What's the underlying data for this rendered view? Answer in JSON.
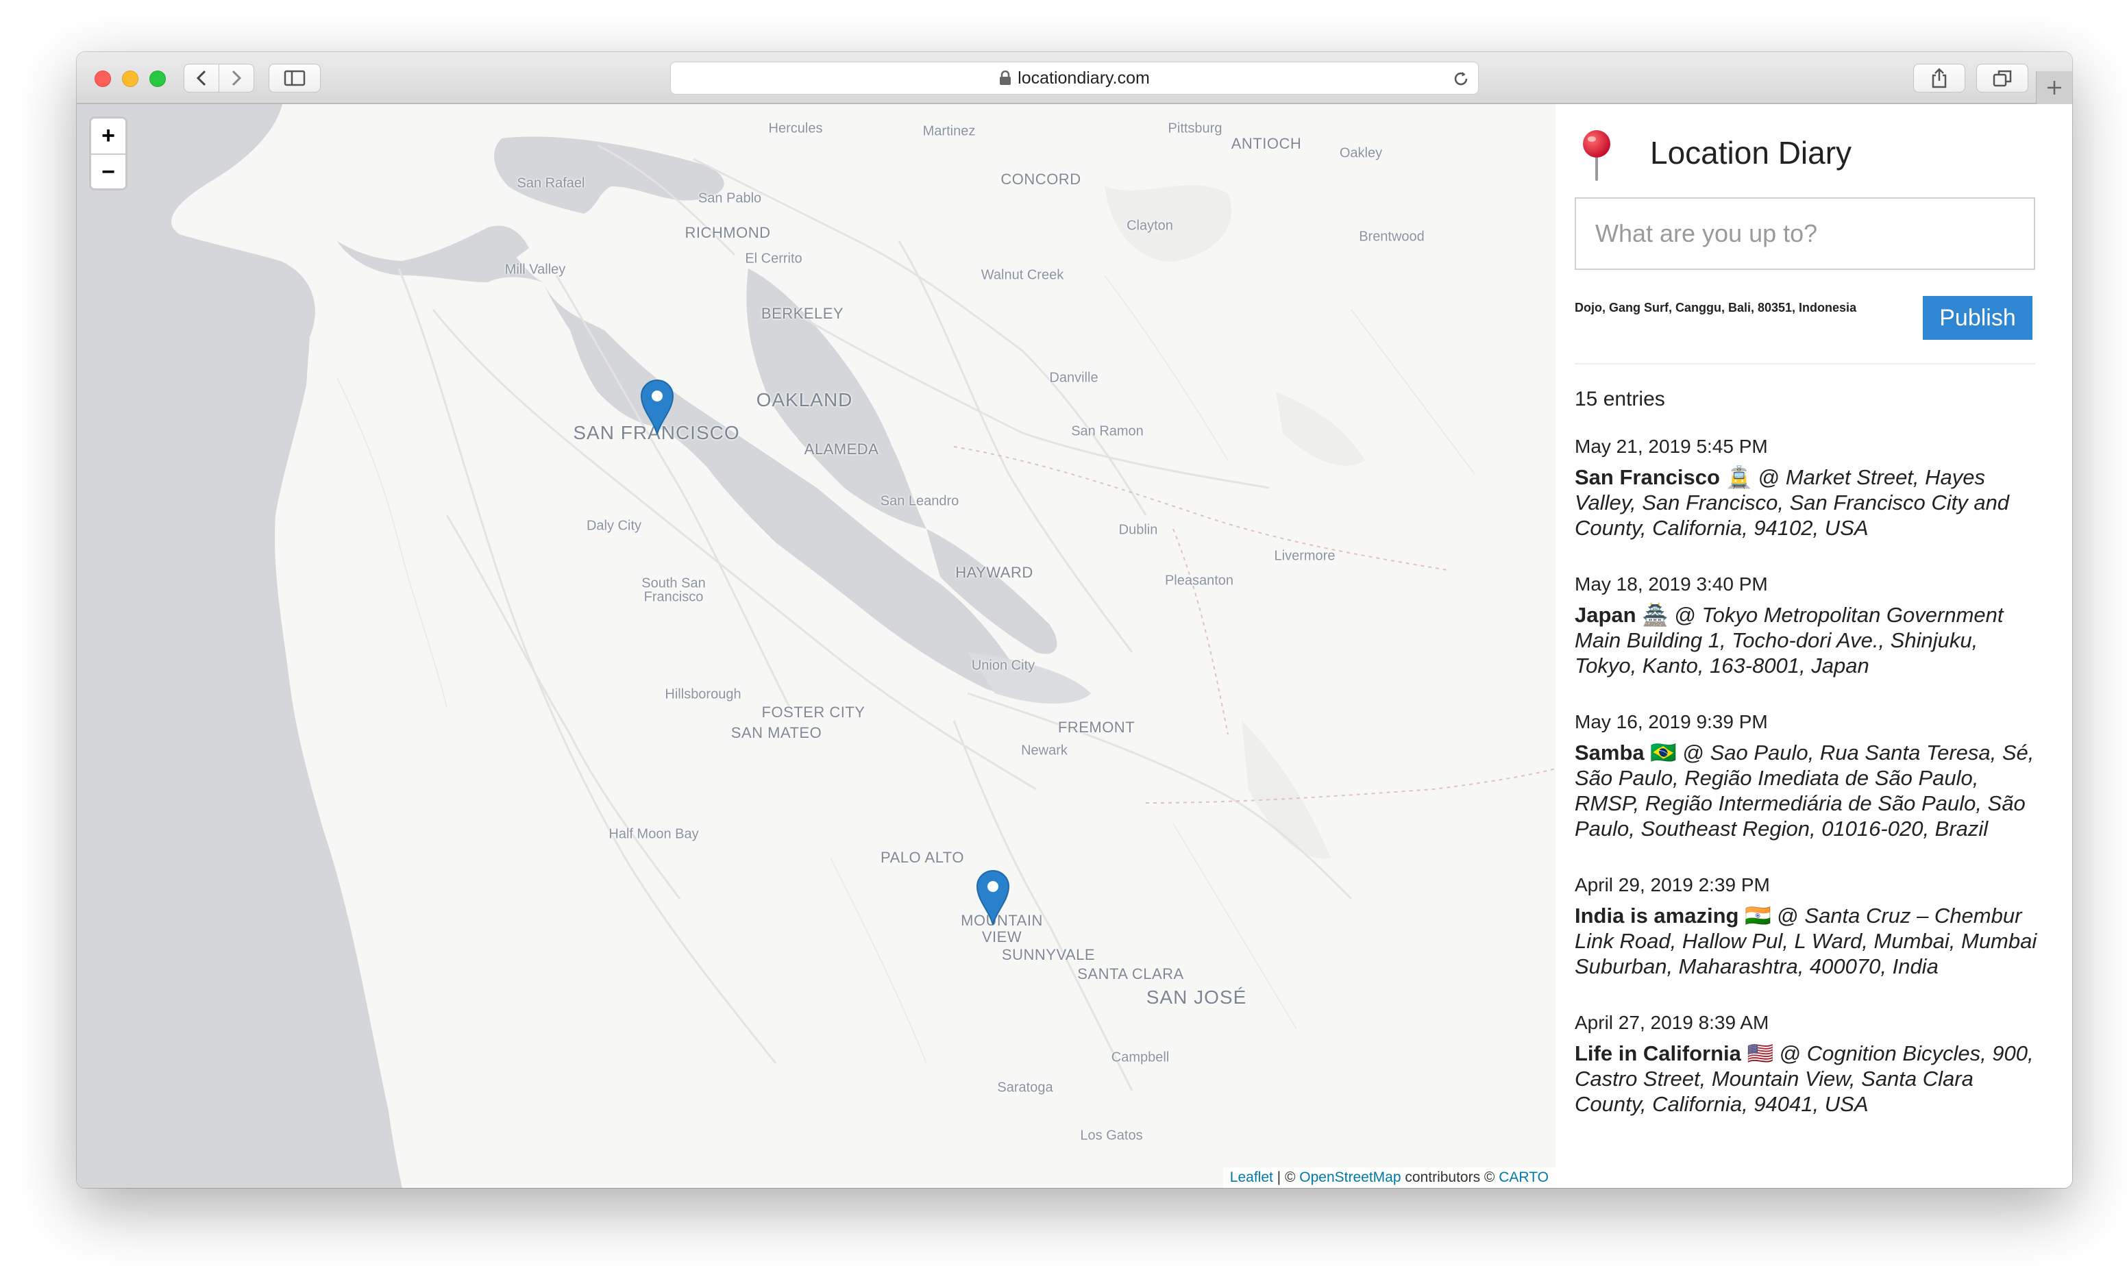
{
  "browser": {
    "url": "locationdiary.com",
    "icons": [
      "back-icon",
      "forward-icon",
      "sidebar-icon",
      "lock-icon",
      "reload-icon",
      "share-icon",
      "tabs-icon",
      "plus-icon"
    ]
  },
  "map": {
    "zoom_in_label": "+",
    "zoom_out_label": "−",
    "labels": {
      "hercules": "Hercules",
      "martinez": "Martinez",
      "pittsburg": "Pittsburg",
      "antioch": "ANTIOCH",
      "oakley": "Oakley",
      "san_rafael": "San Rafael",
      "san_pablo": "San Pablo",
      "concord": "CONCORD",
      "richmond": "RICHMOND",
      "clayton": "Clayton",
      "brentwood": "Brentwood",
      "el_cerrito": "El Cerrito",
      "mill_valley": "Mill Valley",
      "walnut_creek": "Walnut Creek",
      "berkeley": "BERKELEY",
      "danville": "Danville",
      "oakland": "OAKLAND",
      "san_francisco": "SAN FRANCISCO",
      "san_ramon": "San Ramon",
      "alameda": "ALAMEDA",
      "san_leandro": "San Leandro",
      "daly_city": "Daly City",
      "dublin": "Dublin",
      "livermore": "Livermore",
      "hayward": "HAYWARD",
      "pleasanton": "Pleasanton",
      "south_sf_1": "South San",
      "south_sf_2": "Francisco",
      "union_city": "Union City",
      "hillsborough": "Hillsborough",
      "foster_city": "FOSTER CITY",
      "san_mateo": "SAN MATEO",
      "fremont": "FREMONT",
      "newark": "Newark",
      "half_moon_bay": "Half Moon Bay",
      "palo_alto": "PALO ALTO",
      "mountain_view_1": "MOUNTAIN",
      "mountain_view_2": "VIEW",
      "sunnyvale": "SUNNYVALE",
      "santa_clara": "SANTA CLARA",
      "san_jose": "SAN JOSÉ",
      "campbell": "Campbell",
      "saratoga": "Saratoga",
      "los_gatos": "Los Gatos"
    },
    "attribution": {
      "leaflet": "Leaflet",
      "sep1": " | © ",
      "osm": "OpenStreetMap",
      "contributors": " contributors © ",
      "carto": "CARTO"
    },
    "colors": {
      "water": "#d4d6d9",
      "land": "#f7f7f5",
      "marker": "#2a81cb"
    }
  },
  "diary": {
    "title": "Location Diary",
    "input_placeholder": "What are you up to?",
    "current_location": "Dojo, Gang Surf, Canggu, Bali, 80351, Indonesia",
    "publish_label": "Publish",
    "entry_count": "15 entries",
    "accent_color": "#2f86d3",
    "entries": [
      {
        "date": "May 21, 2019 5:45 PM",
        "title": "San Francisco",
        "emoji": "🚊",
        "at": " @ ",
        "address": "Market Street, Hayes Valley, San Francisco, San Francisco City and County, California, 94102, USA"
      },
      {
        "date": "May 18, 2019 3:40 PM",
        "title": "Japan",
        "emoji": "🏯",
        "at": " @ ",
        "address": "Tokyo Metropolitan Government Main Building 1, Tocho-dori Ave., Shinjuku, Tokyo, Kanto, 163-8001, Japan"
      },
      {
        "date": "May 16, 2019 9:39 PM",
        "title": "Samba",
        "emoji": "🇧🇷",
        "at": " @ ",
        "address": "Sao Paulo, Rua Santa Teresa, Sé, São Paulo, Região Imediata de São Paulo, RMSP, Região Intermediária de São Paulo, São Paulo, Southeast Region, 01016-020, Brazil"
      },
      {
        "date": "April 29, 2019 2:39 PM",
        "title": "India is amazing",
        "emoji": "🇮🇳",
        "at": " @ ",
        "address": "Santa Cruz – Chembur Link Road, Hallow Pul, L Ward, Mumbai, Mumbai Suburban, Maharashtra, 400070, India"
      },
      {
        "date": "April 27, 2019 8:39 AM",
        "title": "Life in California",
        "emoji": "🇺🇸",
        "at": " @ ",
        "address": "Cognition Bicycles, 900, Castro Street, Mountain View, Santa Clara County, California, 94041, USA"
      }
    ]
  }
}
